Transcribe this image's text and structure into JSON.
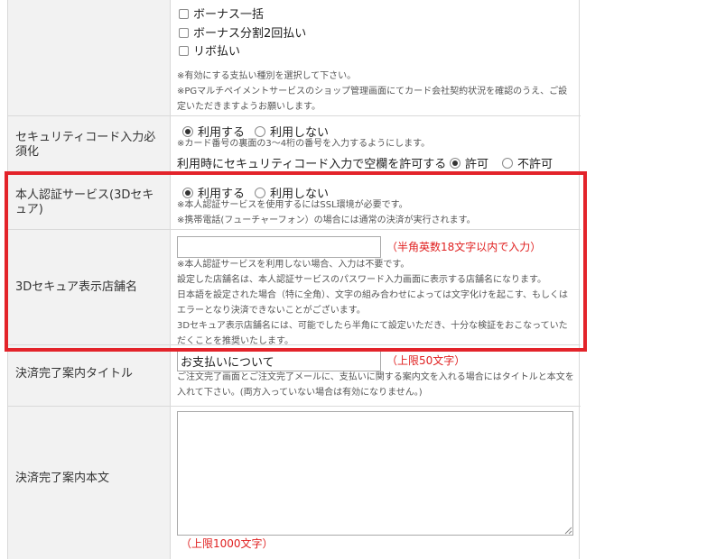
{
  "payment_methods": {
    "options": [
      {
        "label": "ボーナス一括",
        "checked": false
      },
      {
        "label": "ボーナス分割2回払い",
        "checked": false
      },
      {
        "label": "リボ払い",
        "checked": false
      }
    ],
    "note1": "※有効にする支払い種別を選択して下さい。",
    "note2": "※PGマルチペイメントサービスのショップ管理画面にてカード会社契約状況を確認のうえ、ご設定いただきますようお願いします。"
  },
  "security_code": {
    "label": "セキュリティコード入力必須化",
    "use_label": "利用する",
    "not_use_label": "利用しない",
    "selected": "use",
    "note": "※カード番号の裏面の3～4桁の番号を入力するようにします。",
    "blank_label": "利用時にセキュリティコード入力で空欄を許可する",
    "allow_label": "許可",
    "deny_label": "不許可",
    "blank_selected": "allow"
  },
  "three_d": {
    "label": "本人認証サービス(3Dセキュア)",
    "use_label": "利用する",
    "not_use_label": "利用しない",
    "selected": "use",
    "note1": "※本人認証サービスを使用するにはSSL環境が必要です。",
    "note2": "※携帯電話(フューチャーフォン）の場合には通常の決済が実行されます。"
  },
  "three_d_shop": {
    "label": "3Dセキュア表示店舗名",
    "value": "",
    "hint": "（半角英数18文字以内で入力）",
    "note1": "※本人認証サービスを利用しない場合、入力は不要です。",
    "note2": "設定した店舗名は、本人認証サービスのパスワード入力画面に表示する店舗名になります。",
    "note3": "日本語を設定された場合（特に全角）、文字の組み合わせによっては文字化けを起こす、もしくはエラーとなり決済できないことがございます。",
    "note4": "3Dセキュア表示店舗名には、可能でしたら半角にて設定いただき、十分な検証をおこなっていただくことを推奨いたします。"
  },
  "complete_title": {
    "label": "決済完了案内タイトル",
    "value": "お支払いについて",
    "hint": "（上限50文字）",
    "note": "ご注文完了画面とご注文完了メールに、支払いに関する案内文を入れる場合にはタイトルと本文を入れて下さい。(両方入っていない場合は有効になりません。)"
  },
  "complete_body": {
    "label": "決済完了案内本文",
    "value": "",
    "hint": "（上限1000文字）"
  },
  "colors": {
    "highlight": "#e3232a",
    "label_bg": "#f2f2f2",
    "hint_red": "#e02020"
  }
}
